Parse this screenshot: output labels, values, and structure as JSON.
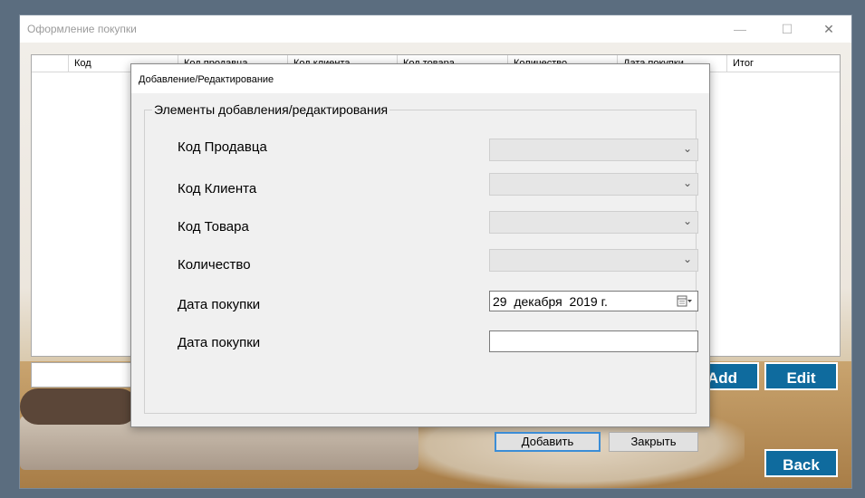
{
  "main_window": {
    "title": "Оформление покупки",
    "controls": {
      "minimize": "—",
      "maximize": "☐",
      "close": "✕"
    },
    "grid": {
      "columns": [
        "",
        "Код",
        "Код продавца",
        "Код клиента",
        "Код товара",
        "Количество",
        "Дата покупки",
        "Итог"
      ]
    },
    "buttons": {
      "add": "Add",
      "edit": "Edit",
      "back": "Back"
    }
  },
  "dialog": {
    "title": "Добавление/Редактирование",
    "group_title": "Элементы добавления/редактирования",
    "fields": [
      {
        "label": "Код Продавца",
        "type": "combo",
        "value": ""
      },
      {
        "label": "Код Клиента",
        "type": "combo",
        "value": ""
      },
      {
        "label": "Код Товара",
        "type": "combo",
        "value": ""
      },
      {
        "label": "Количество",
        "type": "combo",
        "value": ""
      },
      {
        "label": "Дата покупки",
        "type": "date",
        "value": "29  декабря  2019 г."
      },
      {
        "label": "Дата покупки",
        "type": "text",
        "value": ""
      }
    ],
    "buttons": {
      "add": "Добавить",
      "close": "Закрыть"
    }
  },
  "colors": {
    "accent_button": "#0f6b9e",
    "focus_border": "#3b8dd6"
  }
}
